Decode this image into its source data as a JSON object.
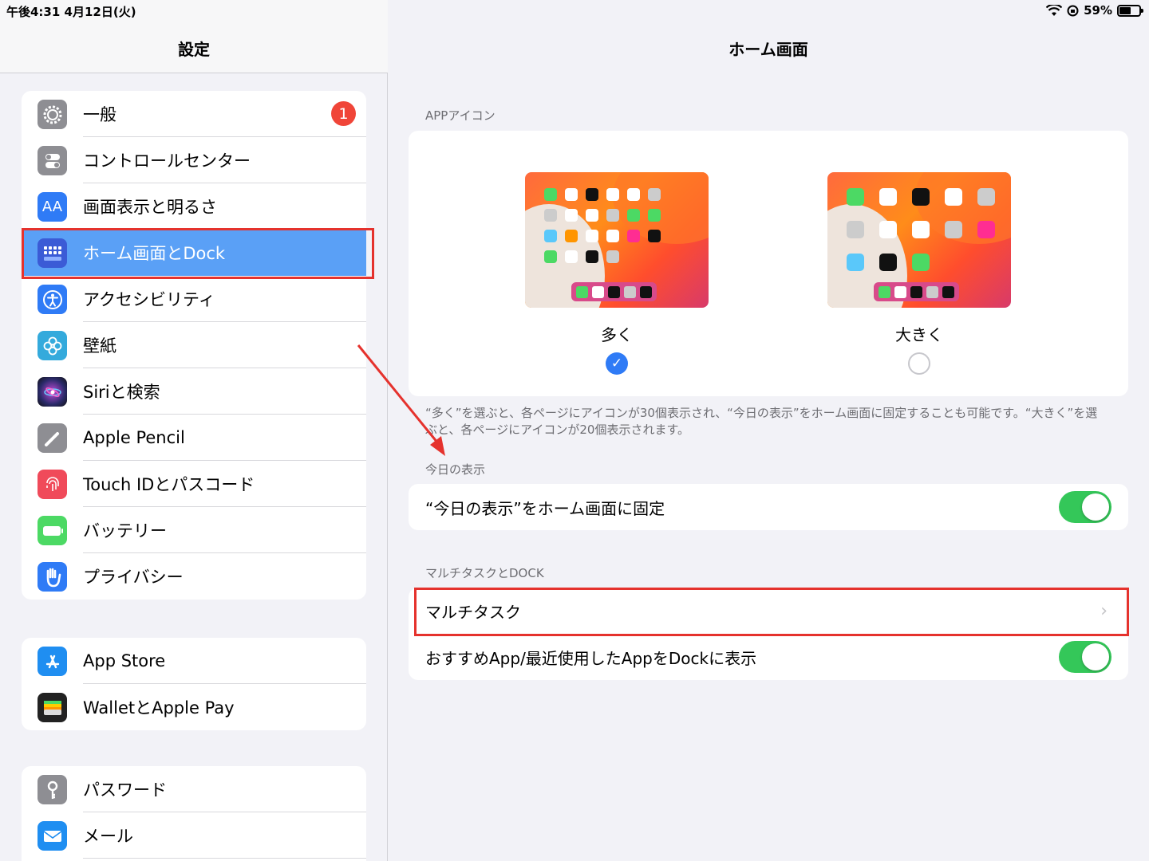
{
  "status": {
    "time_date": "午後4:31  4月12日(火)",
    "battery": "59%",
    "battery_level": 0.59
  },
  "sidebar": {
    "title": "設定",
    "group1": [
      {
        "label": "一般",
        "icon": "gear-icon",
        "badge": "1"
      },
      {
        "label": "コントロールセンター",
        "icon": "toggles-icon"
      },
      {
        "label": "画面表示と明るさ",
        "icon": "aa-icon",
        "icon_text": "AA"
      },
      {
        "label": "ホーム画面とDock",
        "icon": "home-grid-icon",
        "selected": true
      },
      {
        "label": "アクセシビリティ",
        "icon": "accessibility-icon"
      },
      {
        "label": "壁紙",
        "icon": "flower-icon"
      },
      {
        "label": "Siriと検索",
        "icon": "siri-icon"
      },
      {
        "label": "Apple Pencil",
        "icon": "pencil-icon"
      },
      {
        "label": "Touch IDとパスコード",
        "icon": "fingerprint-icon"
      },
      {
        "label": "バッテリー",
        "icon": "battery-icon"
      },
      {
        "label": "プライバシー",
        "icon": "hand-icon"
      }
    ],
    "group2": [
      {
        "label": "App Store",
        "icon": "app-store-icon"
      },
      {
        "label": "WalletとApple Pay",
        "icon": "wallet-icon"
      }
    ],
    "group3": [
      {
        "label": "パスワード",
        "icon": "key-icon"
      },
      {
        "label": "メール",
        "icon": "mail-icon"
      }
    ]
  },
  "detail": {
    "title": "ホーム画面",
    "app_icons_section": "APPアイコン",
    "option_more": "多く",
    "option_large": "大きく",
    "footnote": "“多く”を選ぶと、各ページにアイコンが30個表示され、“今日の表示”をホーム画面に固定することも可能です。“大きく”を選ぶと、各ページにアイコンが20個表示されます。",
    "today_section": "今日の表示",
    "today_pin_label": "“今日の表示”をホーム画面に固定",
    "multitask_section": "マルチタスクとDOCK",
    "multitask_label": "マルチタスク",
    "dock_suggest_label": "おすすめApp/最近使用したAppをDockに表示"
  },
  "colors": {
    "accent": "#2f7bf6",
    "toggle_on": "#34c759",
    "highlight": "#e5322d",
    "selected_row": "#5aa0f6"
  }
}
